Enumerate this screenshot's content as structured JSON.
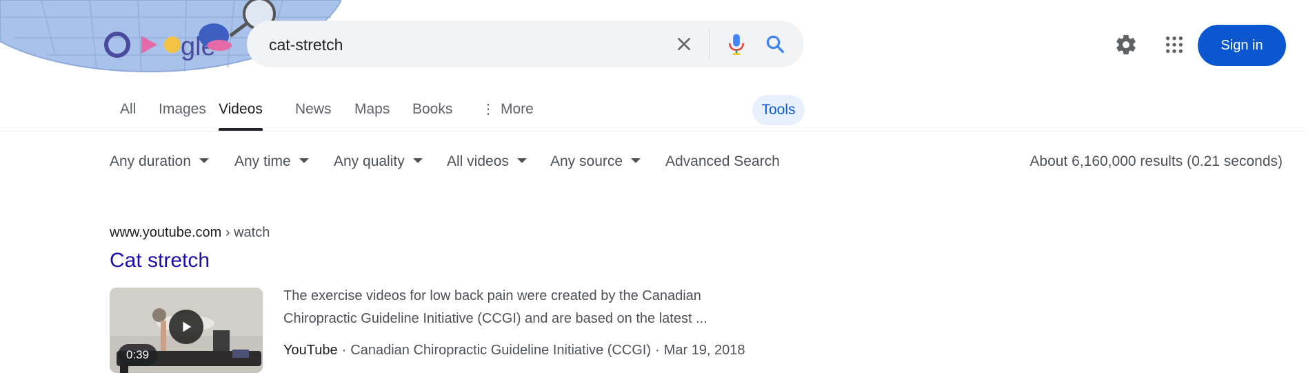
{
  "doodle": {
    "logo_letters": "Google"
  },
  "search": {
    "query": "cat-stretch"
  },
  "header": {
    "signin_label": "Sign in"
  },
  "tabs": [
    {
      "label": "All"
    },
    {
      "label": "Images"
    },
    {
      "label": "Videos",
      "active": true
    },
    {
      "label": "News"
    },
    {
      "label": "Maps"
    },
    {
      "label": "Books"
    },
    {
      "label": "More"
    }
  ],
  "tools_label": "Tools",
  "filters": [
    {
      "label": "Any duration"
    },
    {
      "label": "Any time"
    },
    {
      "label": "Any quality"
    },
    {
      "label": "All videos"
    },
    {
      "label": "Any source"
    }
  ],
  "advanced_search_label": "Advanced Search",
  "results_stats": "About 6,160,000 results (0.21 seconds)",
  "result": {
    "site": "www.youtube.com",
    "path": "› watch",
    "title": "Cat stretch",
    "duration": "0:39",
    "snippet_line1": "The exercise videos for low back pain were created by the Canadian",
    "snippet_line2": "Chiropractic Guideline Initiative (CCGI) and are based on the latest ...",
    "source": "YouTube",
    "channel": "Canadian Chiropractic Guideline Initiative (CCGI)",
    "date": "Mar 19, 2018",
    "separator": "·"
  },
  "colors": {
    "accent": "#0b57d0",
    "link": "#1a0dab",
    "tools_bg": "#e8f0fe",
    "search_bg": "#f1f3f4"
  },
  "icons": [
    "clear-icon",
    "mic-icon",
    "search-icon",
    "gear-icon",
    "apps-grid-icon",
    "more-dots-icon",
    "play-icon",
    "dropdown-caret-icon"
  ]
}
